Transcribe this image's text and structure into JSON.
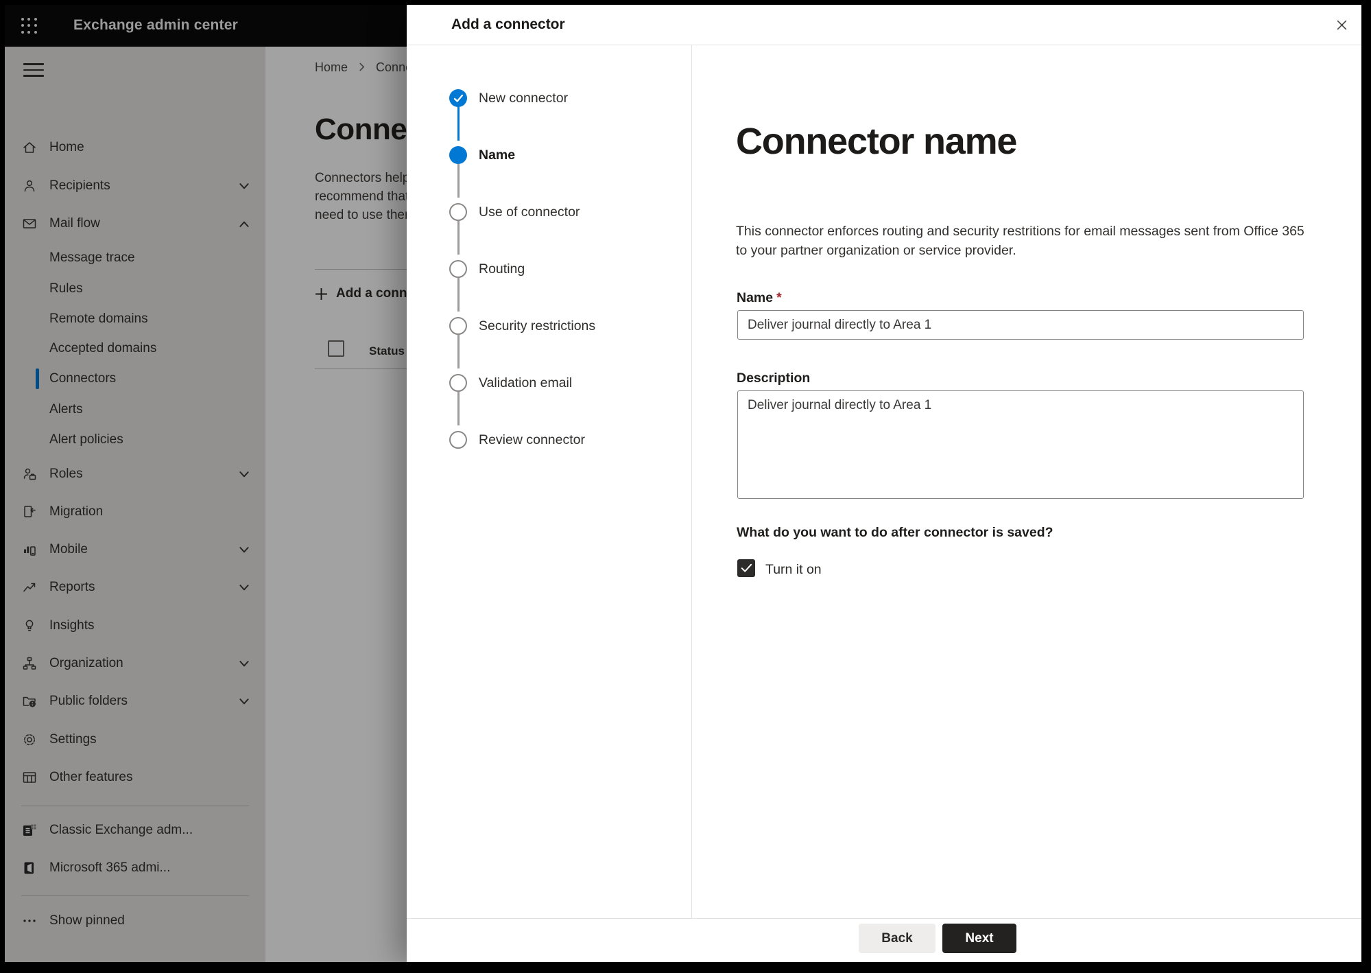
{
  "top_bar": {
    "title": "Exchange admin center"
  },
  "sidebar": {
    "items": [
      {
        "label": "Home",
        "icon": "home"
      },
      {
        "label": "Recipients",
        "icon": "person",
        "chevron": "down"
      },
      {
        "label": "Mail flow",
        "icon": "mail",
        "chevron": "up",
        "expanded": true
      },
      {
        "label": "Message trace",
        "type": "sub"
      },
      {
        "label": "Rules",
        "type": "sub"
      },
      {
        "label": "Remote domains",
        "type": "sub"
      },
      {
        "label": "Accepted domains",
        "type": "sub"
      },
      {
        "label": "Connectors",
        "type": "sub",
        "selected": true
      },
      {
        "label": "Alerts",
        "type": "sub"
      },
      {
        "label": "Alert policies",
        "type": "sub"
      },
      {
        "label": "Roles",
        "icon": "roles",
        "chevron": "down"
      },
      {
        "label": "Migration",
        "icon": "migration"
      },
      {
        "label": "Mobile",
        "icon": "mobile",
        "chevron": "down"
      },
      {
        "label": "Reports",
        "icon": "reports",
        "chevron": "down"
      },
      {
        "label": "Insights",
        "icon": "insights"
      },
      {
        "label": "Organization",
        "icon": "organization",
        "chevron": "down"
      },
      {
        "label": "Public folders",
        "icon": "public-folders",
        "chevron": "down"
      },
      {
        "label": "Settings",
        "icon": "settings"
      },
      {
        "label": "Other features",
        "icon": "other-features"
      },
      {
        "label": "Classic Exchange adm...",
        "icon": "classic-exchange"
      },
      {
        "label": "Microsoft 365 admi...",
        "icon": "microsoft-365"
      },
      {
        "label": "Show pinned",
        "icon": "ellipsis"
      }
    ]
  },
  "page": {
    "breadcrumb": {
      "home": "Home",
      "current": "Connectors"
    },
    "title": "Connectors",
    "intro_lines": [
      "Connectors help",
      "recommend that",
      "need to use them"
    ],
    "add_button": "Add a connector",
    "table": {
      "status_column": "Status"
    }
  },
  "dialog": {
    "title": "Add a connector",
    "steps": [
      {
        "label": "New connector",
        "state": "completed"
      },
      {
        "label": "Name",
        "state": "current"
      },
      {
        "label": "Use of connector",
        "state": "upcoming"
      },
      {
        "label": "Routing",
        "state": "upcoming"
      },
      {
        "label": "Security restrictions",
        "state": "upcoming"
      },
      {
        "label": "Validation email",
        "state": "upcoming"
      },
      {
        "label": "Review connector",
        "state": "upcoming"
      }
    ],
    "content": {
      "heading": "Connector name",
      "intro_lines": [
        "This connector enforces routing and security restritions for email messages sent from Office 365",
        "to your partner organization or service provider."
      ],
      "name_label": "Name",
      "required_marker": "*",
      "name_value": "Deliver journal directly to Area 1",
      "description_label": "Description",
      "description_value": "Deliver journal directly to Area 1",
      "question": "What do you want to do after connector is saved?",
      "checkbox_label": "Turn it on",
      "checkbox_checked": true
    },
    "footer": {
      "back": "Back",
      "next": "Next"
    }
  },
  "colors": {
    "accent": "#0078d4",
    "next_button": "#232221",
    "required": "#a4262c",
    "overlay": "rgba(0,0,0,0.365)"
  }
}
